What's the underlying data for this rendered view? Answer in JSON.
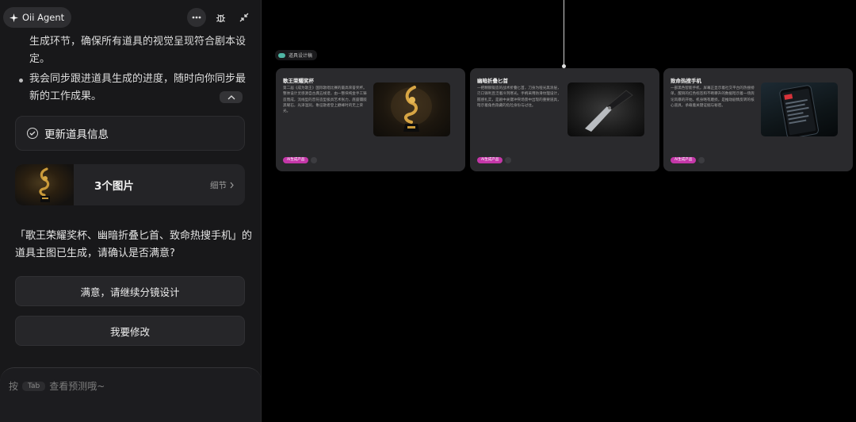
{
  "header": {
    "agent_name": "Oii Agent",
    "icons": [
      "sparkle-icon",
      "more-dots-icon",
      "bug-icon",
      "collapse-arrows-icon"
    ]
  },
  "chat": {
    "msg_line_top": "生成环节，确保所有道具的视觉呈现符合剧本设定。",
    "bullet_2": "我会同步跟进道具生成的进度，随时向你同步最新的工作成果。",
    "task_label": "更新道具信息",
    "image_count": "3个图片",
    "detail_label": "细节",
    "prompt": "「歌王荣耀奖杯、幽暗折叠匕首、致命热搜手机」的道具主图已生成，请确认是否满意?",
    "confirm_button": "满意，请继续分镜设计",
    "modify_button": "我要修改"
  },
  "input": {
    "hint_prefix": "按",
    "tab_key": "Tab",
    "hint_suffix": "查看预测哦~"
  },
  "canvas": {
    "group_label": "道具设计稿",
    "cards": [
      {
        "title": "歌王荣耀奖杯",
        "desc": "第二届《成为歌王》国际歌唱比赛的最高荣誉奖杯。整体设计灵感源自古典五线谱，由一整块纯金手工铸造而成，流线型的音符造型极具艺术张力，底座镶嵌黑曜石，光泽温润，象征歌者登上巅峰时的无上荣光。",
        "tag": "AI生成产品"
      },
      {
        "title": "幽暗折叠匕首",
        "desc": "一把精钢锻造的战术折叠匕首，刀身为哑光黑涂层，刃口锋利且泛着冷冽寒光。手柄采用防滑纹理设计，握感扎实，是剧中关键冲突场景中出现的重要道具，暗示着角色隐藏的危险身份与过往。",
        "tag": "AI生成产品"
      },
      {
        "title": "致命热搜手机",
        "desc": "一部黑色智能手机，屏幕正显示着社交平台的热搜榜单，醒目的红色标签和不断攀升的数据暗示着一场舆论风暴的开始。机身略有磨损，是推动剧情反转的核心道具，承载着关键证据与秘密。",
        "tag": "AI生成产品"
      }
    ]
  }
}
